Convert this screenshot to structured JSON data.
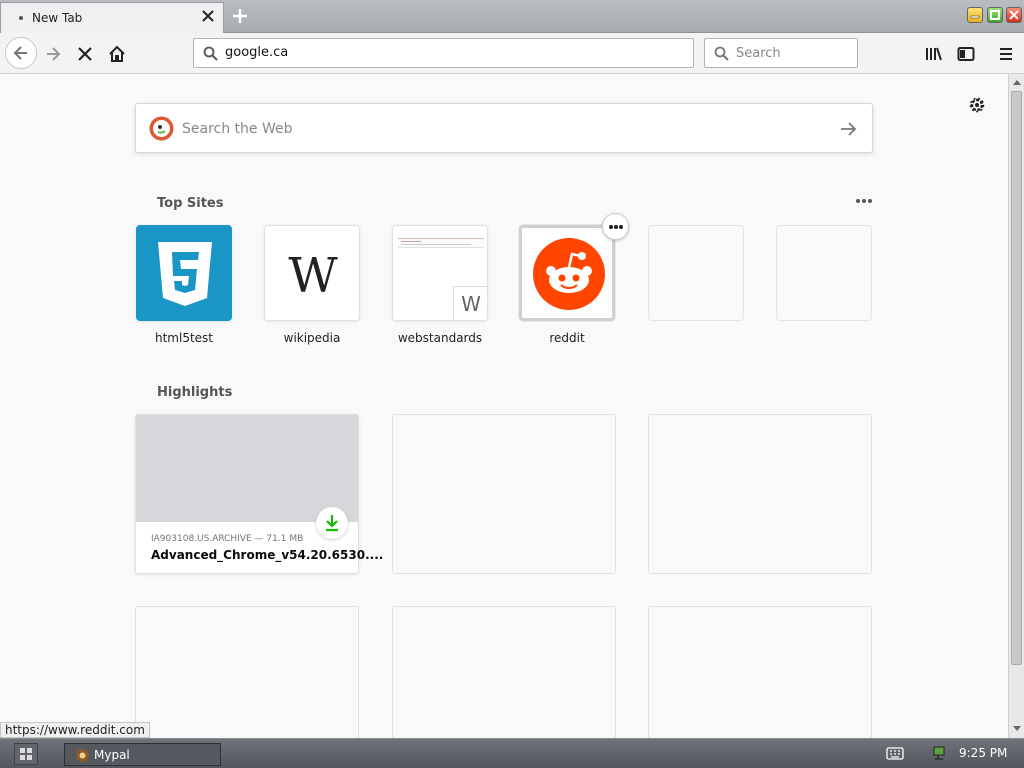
{
  "tab": {
    "title": "New Tab"
  },
  "toolbar": {
    "url": "google.ca",
    "search_placeholder": "Search"
  },
  "page": {
    "web_search_placeholder": "Search the Web",
    "top_sites_heading": "Top Sites",
    "highlights_heading": "Highlights",
    "top_sites": [
      {
        "label": "html5test"
      },
      {
        "label": "wikipedia",
        "glyph": "W"
      },
      {
        "label": "webstandards",
        "badge": "W"
      },
      {
        "label": "reddit"
      }
    ],
    "highlight": {
      "source": "IA903108.US.ARCHIVE — 71.1 MB",
      "title": "Advanced_Chrome_v54.20.6530...."
    }
  },
  "statusbar": {
    "text": "https://www.reddit.com"
  },
  "taskbar": {
    "app": "Mypal",
    "time": "9:25 PM"
  },
  "colors": {
    "html5": "#1a96c6",
    "reddit": "#ff4500",
    "download": "#12bc00"
  }
}
